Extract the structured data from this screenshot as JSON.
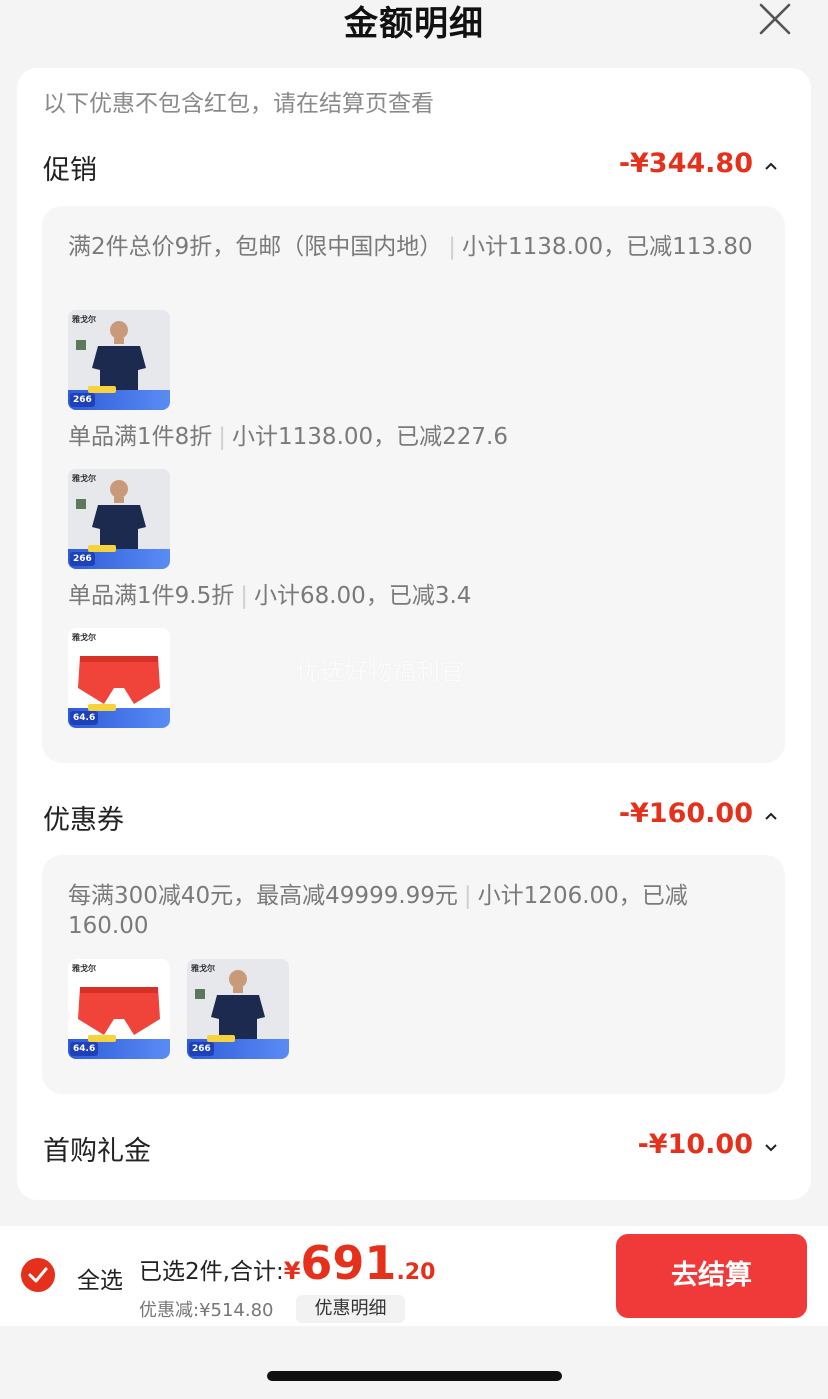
{
  "header": {
    "title": "金额明细"
  },
  "note": "以下优惠不包含红包，请在结算页查看",
  "sections": [
    {
      "label": "促销",
      "amount": "-¥344.80",
      "rules": [
        {
          "text": "满2件总价9折，包邮（限中国内地）",
          "sub": "小计1138.00，已减113.80",
          "thumbs": [
            {
              "kind": "shirt",
              "price": "266"
            }
          ]
        },
        {
          "text": "单品满1件8折",
          "sub": "小计1138.00，已减227.6",
          "thumbs": [
            {
              "kind": "shirt",
              "price": "266"
            }
          ]
        },
        {
          "text": "单品满1件9.5折",
          "sub": "小计68.00，已减3.4",
          "thumbs": [
            {
              "kind": "underwear",
              "price": "64.6"
            }
          ]
        }
      ]
    },
    {
      "label": "优惠券",
      "amount": "-¥160.00",
      "rules": [
        {
          "text": "每满300减40元，最高减49999.99元",
          "sub": "小计1206.00，已减160.00",
          "thumbs": [
            {
              "kind": "underwear",
              "price": "64.6"
            },
            {
              "kind": "shirt",
              "price": "266"
            }
          ]
        }
      ]
    },
    {
      "label": "首购礼金",
      "amount": "-¥10.00"
    }
  ],
  "watermark": "优选好物福利官",
  "thumb_brand": "雅戈尔",
  "footer": {
    "select_all": "全选",
    "summary_label": "已选2件,合计:",
    "currency": "¥",
    "total_int": "691",
    "total_dec": ".20",
    "discount_text": "优惠减:¥514.80",
    "detail_button": "优惠明细",
    "checkout_button": "去结算"
  },
  "colors": {
    "accent": "#e5311c",
    "checkout": "#f03a3a"
  }
}
